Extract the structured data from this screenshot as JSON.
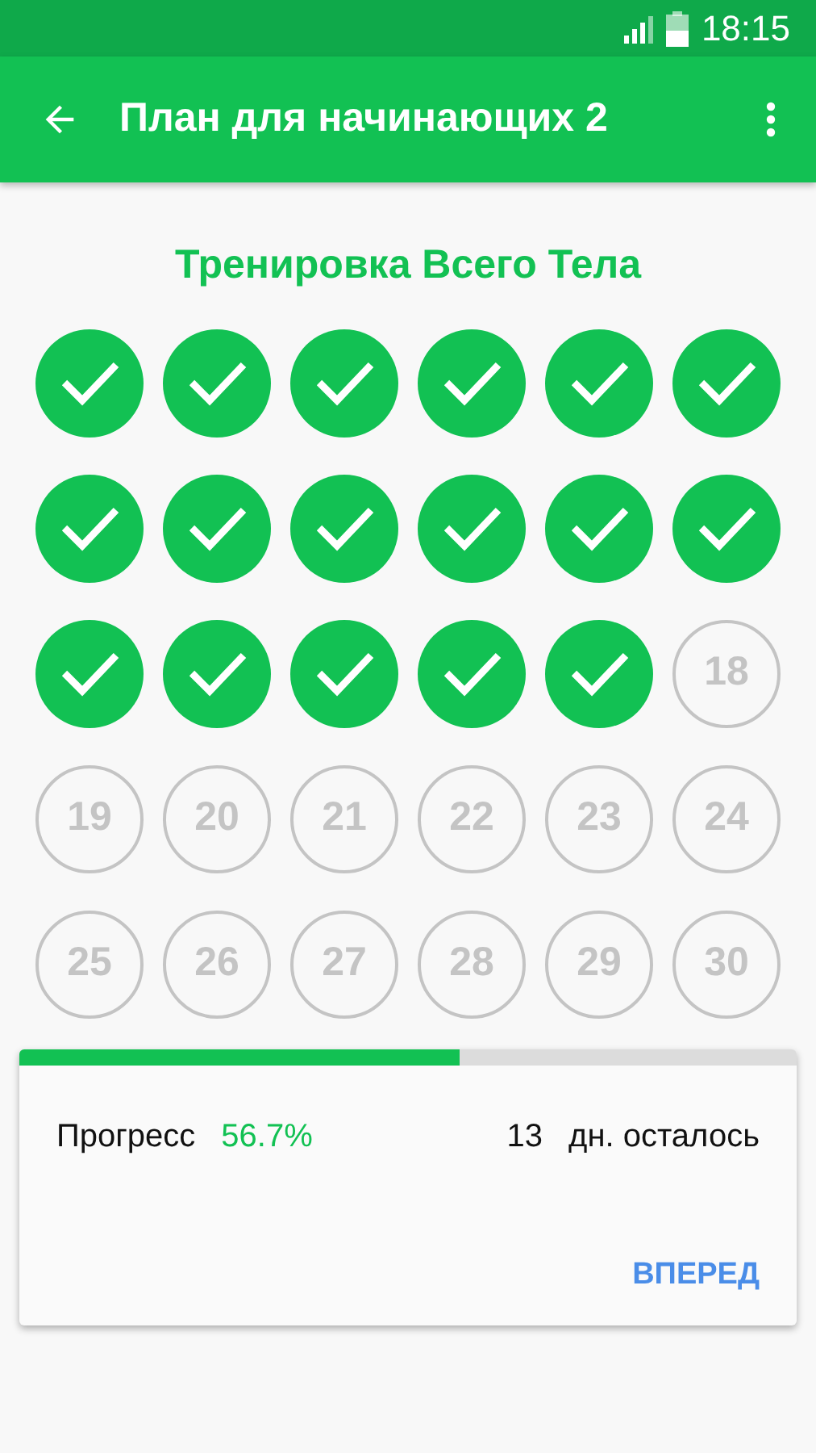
{
  "status_bar": {
    "time": "18:15"
  },
  "app_bar": {
    "title": "План для начинающих 2"
  },
  "plan": {
    "title": "Тренировка Всего Тела"
  },
  "days": [
    {
      "done": true
    },
    {
      "done": true
    },
    {
      "done": true
    },
    {
      "done": true
    },
    {
      "done": true
    },
    {
      "done": true
    },
    {
      "done": true
    },
    {
      "done": true
    },
    {
      "done": true
    },
    {
      "done": true
    },
    {
      "done": true
    },
    {
      "done": true
    },
    {
      "done": true
    },
    {
      "done": true
    },
    {
      "done": true
    },
    {
      "done": true
    },
    {
      "done": true
    },
    {
      "label": "18",
      "done": false
    },
    {
      "label": "19",
      "done": false
    },
    {
      "label": "20",
      "done": false
    },
    {
      "label": "21",
      "done": false
    },
    {
      "label": "22",
      "done": false
    },
    {
      "label": "23",
      "done": false
    },
    {
      "label": "24",
      "done": false
    },
    {
      "label": "25",
      "done": false
    },
    {
      "label": "26",
      "done": false
    },
    {
      "label": "27",
      "done": false
    },
    {
      "label": "28",
      "done": false
    },
    {
      "label": "29",
      "done": false
    },
    {
      "label": "30",
      "done": false
    }
  ],
  "progress": {
    "level": 0.567,
    "label": "Прогресс",
    "value": "56.7%",
    "days_count": "13",
    "days_left": "дн. осталось",
    "button": "ВПЕРЕД"
  }
}
